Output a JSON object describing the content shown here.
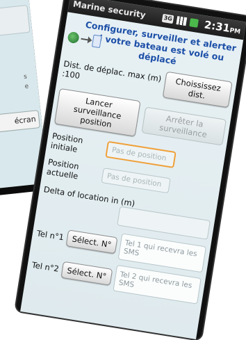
{
  "background_app": {
    "box_text": "s\ne",
    "line1": "s",
    "line2": "e",
    "button_label": "écran"
  },
  "statusbar": {
    "app_title": "Marine security",
    "network": "3G",
    "time": "2:31",
    "ampm": "PM"
  },
  "header": {
    "line1": "Configurer, surveiller et alerter",
    "line2": "si votre bateau est volé ou déplacé"
  },
  "distance": {
    "label": "Dist. de déplac. max (m) :100",
    "button": "Choississez dist."
  },
  "surveillance": {
    "start_button": "Lancer surveillance position",
    "stop_button": "Arrêter la surveillance"
  },
  "position_initiale": {
    "label": "Position initiale",
    "value": "Pas de position"
  },
  "position_actuelle": {
    "label": "Position actuelle",
    "value": "Pas de position"
  },
  "delta": {
    "label": "Delta of location in (m)",
    "value": ""
  },
  "tel1": {
    "label": "Tel n°1",
    "button": "Sélect. N°",
    "placeholder": "Tel 1 qui recevra les SMS"
  },
  "tel2": {
    "label": "Tel n°2",
    "button": "Sélect. N°",
    "placeholder": "Tel 2 qui recevra les SMS"
  },
  "colors": {
    "header_text": "#1d4fa8",
    "focus_border": "#f0a03a",
    "screen_bg": "#e3eef2"
  }
}
